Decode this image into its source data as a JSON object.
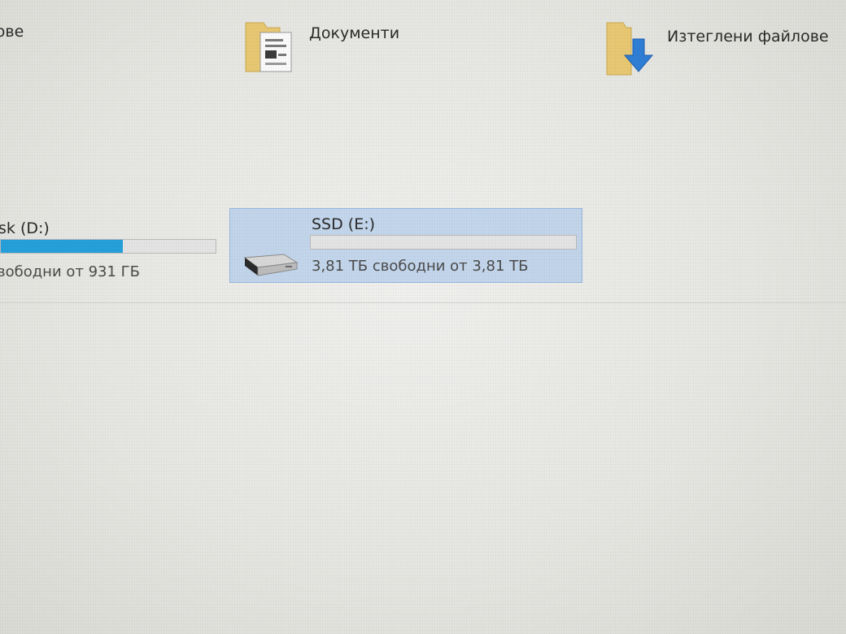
{
  "folders": {
    "images": {
      "label": "ипове",
      "icon": "folder-icon"
    },
    "documents": {
      "label": "Документи",
      "icon": "documents-folder-icon"
    },
    "downloads": {
      "label": "Изтеглени файлове",
      "icon": "downloads-folder-icon"
    }
  },
  "drives": {
    "d": {
      "name": "sk (D:)",
      "free_text": "вободни от 931 ГБ",
      "used_fraction": 0.57,
      "icon": "hard-drive-icon"
    },
    "e": {
      "name": "SSD (E:)",
      "free_text": "3,81 ТБ свободни от 3,81 ТБ",
      "used_fraction": 0.0,
      "selected": true,
      "icon": "ssd-drive-icon"
    }
  },
  "colors": {
    "usage_bar": "#26a0da",
    "selection": "#b4cdeb",
    "folder": "#e8c872",
    "download_arrow": "#2f7fd6"
  }
}
